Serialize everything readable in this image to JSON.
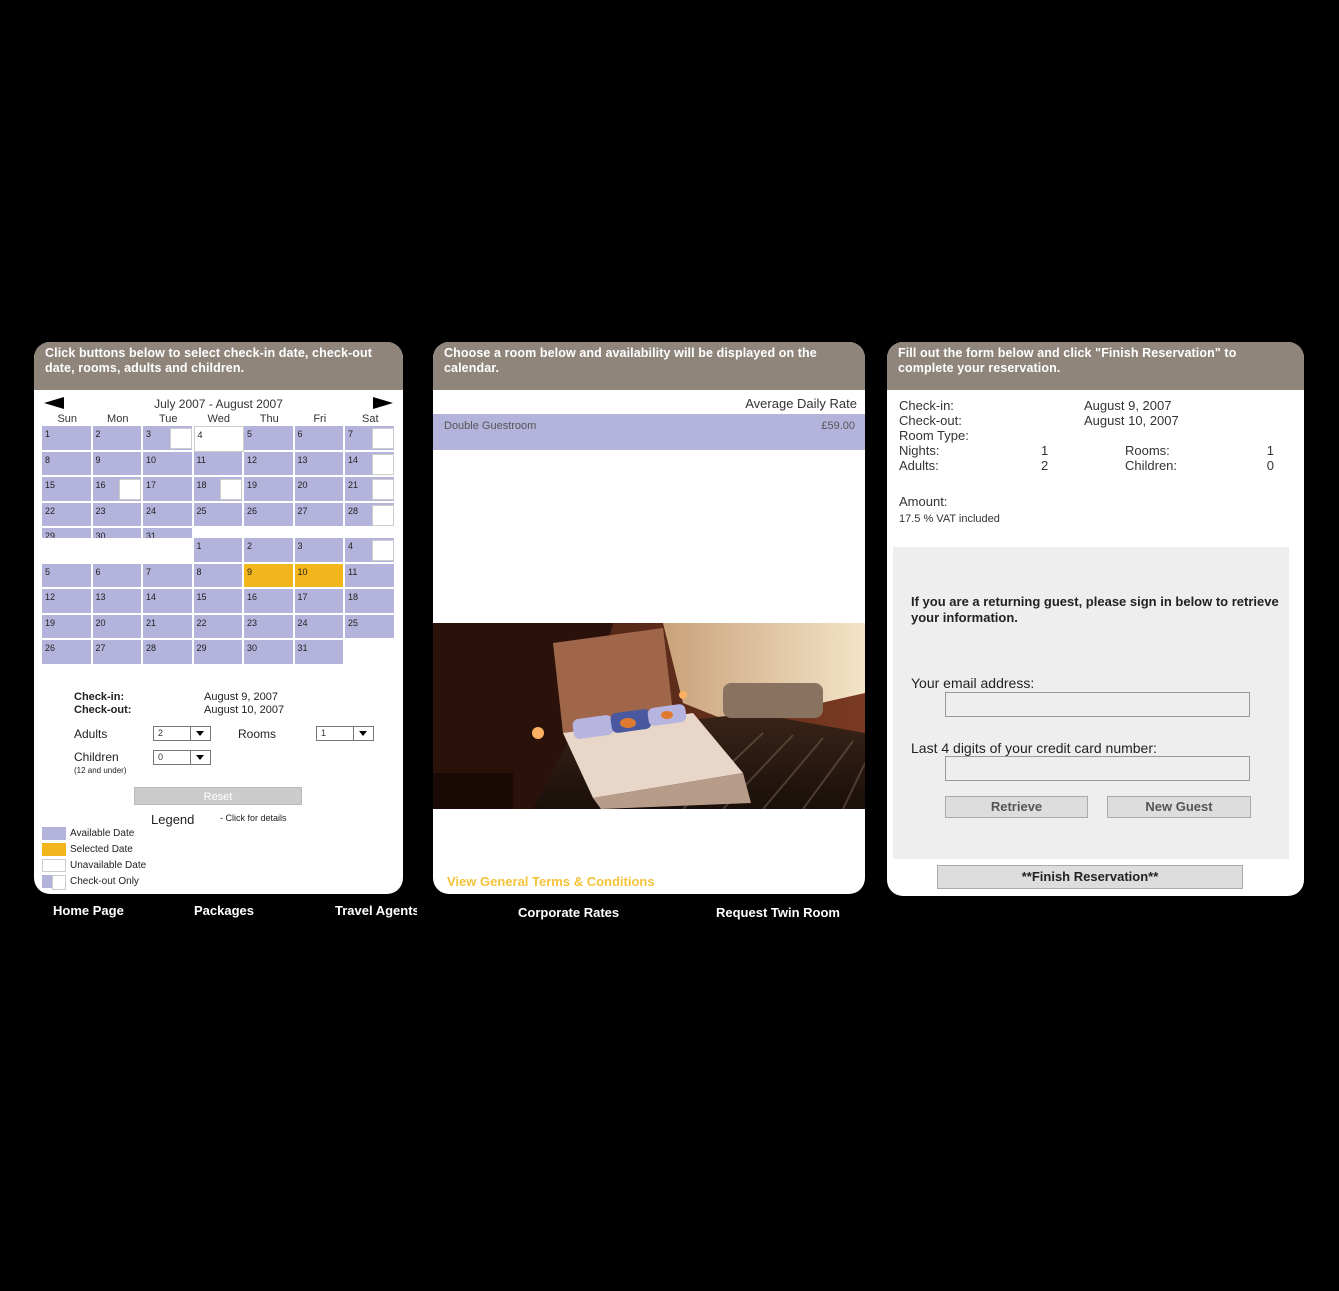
{
  "calendar_panel": {
    "header": "Click buttons below to select check-in date, check-out date, rooms, adults and children.",
    "month_title": "July 2007 - August 2007",
    "weekdays": [
      "Sun",
      "Mon",
      "Tue",
      "Wed",
      "Thu",
      "Fri",
      "Sat"
    ],
    "july": [
      {
        "d": "1",
        "s": "avail"
      },
      {
        "d": "2",
        "s": "avail"
      },
      {
        "d": "3",
        "s": "checkout"
      },
      {
        "d": "4",
        "s": "unavail"
      },
      {
        "d": "5",
        "s": "avail"
      },
      {
        "d": "6",
        "s": "avail"
      },
      {
        "d": "7",
        "s": "checkout"
      },
      {
        "d": "8",
        "s": "avail"
      },
      {
        "d": "9",
        "s": "avail"
      },
      {
        "d": "10",
        "s": "avail"
      },
      {
        "d": "11",
        "s": "avail"
      },
      {
        "d": "12",
        "s": "avail"
      },
      {
        "d": "13",
        "s": "avail"
      },
      {
        "d": "14",
        "s": "checkout"
      },
      {
        "d": "15",
        "s": "avail"
      },
      {
        "d": "16",
        "s": "checkout"
      },
      {
        "d": "17",
        "s": "avail"
      },
      {
        "d": "18",
        "s": "checkout"
      },
      {
        "d": "19",
        "s": "avail"
      },
      {
        "d": "20",
        "s": "avail"
      },
      {
        "d": "21",
        "s": "checkout"
      },
      {
        "d": "22",
        "s": "avail"
      },
      {
        "d": "23",
        "s": "avail"
      },
      {
        "d": "24",
        "s": "avail"
      },
      {
        "d": "25",
        "s": "avail"
      },
      {
        "d": "26",
        "s": "avail"
      },
      {
        "d": "27",
        "s": "avail"
      },
      {
        "d": "28",
        "s": "checkout"
      },
      {
        "d": "29",
        "s": "avail"
      },
      {
        "d": "30",
        "s": "avail"
      },
      {
        "d": "31",
        "s": "avail"
      },
      {
        "d": "",
        "s": "empty"
      },
      {
        "d": "",
        "s": "empty"
      },
      {
        "d": "",
        "s": "empty"
      },
      {
        "d": "",
        "s": "empty"
      }
    ],
    "august": [
      {
        "d": "",
        "s": "empty"
      },
      {
        "d": "",
        "s": "empty"
      },
      {
        "d": "",
        "s": "empty"
      },
      {
        "d": "1",
        "s": "avail"
      },
      {
        "d": "2",
        "s": "avail"
      },
      {
        "d": "3",
        "s": "avail"
      },
      {
        "d": "4",
        "s": "checkout"
      },
      {
        "d": "5",
        "s": "avail"
      },
      {
        "d": "6",
        "s": "avail"
      },
      {
        "d": "7",
        "s": "avail"
      },
      {
        "d": "8",
        "s": "avail"
      },
      {
        "d": "9",
        "s": "sel"
      },
      {
        "d": "10",
        "s": "sel"
      },
      {
        "d": "11",
        "s": "avail"
      },
      {
        "d": "12",
        "s": "avail"
      },
      {
        "d": "13",
        "s": "avail"
      },
      {
        "d": "14",
        "s": "avail"
      },
      {
        "d": "15",
        "s": "avail"
      },
      {
        "d": "16",
        "s": "avail"
      },
      {
        "d": "17",
        "s": "avail"
      },
      {
        "d": "18",
        "s": "avail"
      },
      {
        "d": "19",
        "s": "avail"
      },
      {
        "d": "20",
        "s": "avail"
      },
      {
        "d": "21",
        "s": "avail"
      },
      {
        "d": "22",
        "s": "avail"
      },
      {
        "d": "23",
        "s": "avail"
      },
      {
        "d": "24",
        "s": "avail"
      },
      {
        "d": "25",
        "s": "avail"
      },
      {
        "d": "26",
        "s": "avail"
      },
      {
        "d": "27",
        "s": "avail"
      },
      {
        "d": "28",
        "s": "avail"
      },
      {
        "d": "29",
        "s": "avail"
      },
      {
        "d": "30",
        "s": "avail"
      },
      {
        "d": "31",
        "s": "avail"
      },
      {
        "d": "",
        "s": "empty"
      }
    ],
    "checkin_label": "Check-in:",
    "checkin_value": "August 9, 2007",
    "checkout_label": "Check-out:",
    "checkout_value": "August 10, 2007",
    "adults_label": "Adults",
    "adults_value": "2",
    "rooms_label": "Rooms",
    "rooms_value": "1",
    "children_label": "Children",
    "children_note": "(12 and under)",
    "children_value": "0",
    "reset_label": "Reset",
    "legend_title": "Legend",
    "legend_note": "- Click for details",
    "legend_items": {
      "available": "Available Date",
      "selected": "Selected Date",
      "unavailable": "Unavailable Date",
      "checkout_only": "Check-out Only"
    }
  },
  "rooms_panel": {
    "header": "Choose a room below and availability will be displayed on the calendar.",
    "rate_heading": "Average Daily Rate",
    "room_name": "Double Guestroom",
    "room_price": "£59.00",
    "terms_link": "View General Terms & Conditions"
  },
  "reservation_panel": {
    "header": "Fill out the form below and click \"Finish Reservation\" to complete your reservation.",
    "checkin_label": "Check-in:",
    "checkin_value": "August 9, 2007",
    "checkout_label": "Check-out:",
    "checkout_value": "August 10, 2007",
    "room_type_label": "Room Type:",
    "nights_label": "Nights:",
    "nights_value": "1",
    "rooms_label": "Rooms:",
    "rooms_value": "1",
    "adults_label": "Adults:",
    "adults_value": "2",
    "children_label": "Children:",
    "children_value": "0",
    "amount_label": "Amount:",
    "vat_note": "17.5 % VAT included",
    "signin_text": "If you are a returning guest, please sign in below to retrieve your information.",
    "email_label": "Your email address:",
    "card_label": "Last 4 digits of your credit card number:",
    "retrieve_label": "Retrieve",
    "new_guest_label": "New Guest",
    "finish_label": "**Finish Reservation**"
  },
  "nav": {
    "home": "Home Page",
    "packages": "Packages",
    "travel_agents": "Travel Agents",
    "corporate": "Corporate Rates",
    "twin": "Request Twin Room"
  },
  "colors": {
    "header_bg": "#8f857a",
    "available": "#b3b3dc",
    "selected": "#f2b51c",
    "terms_link": "#f5c23a"
  }
}
